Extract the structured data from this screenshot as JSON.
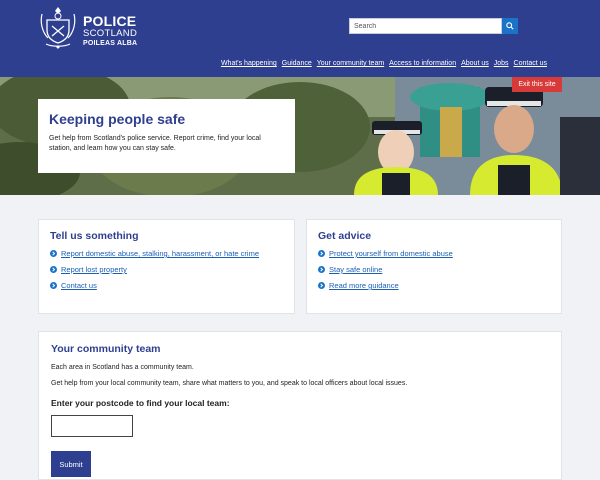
{
  "header": {
    "brand_line1": "POLICE",
    "brand_line2": "SCOTLAND",
    "brand_line3": "POILEAS ALBA",
    "search_placeholder": "Search",
    "nav": [
      "What's happening",
      "Guidance",
      "Your community team",
      "Access to information",
      "About us",
      "Jobs",
      "Contact us"
    ]
  },
  "hero": {
    "exit_label": "Exit this site",
    "title": "Keeping people safe",
    "text": "Get help from Scotland's police service. Report crime, find your local station, and learn how you can stay safe."
  },
  "tell_us": {
    "title": "Tell us something",
    "links": [
      "Report domestic abuse, stalking, harassment, or hate crime",
      "Report lost property",
      "Contact us"
    ]
  },
  "get_advice": {
    "title": "Get advice",
    "links": [
      "Protect yourself from domestic abuse",
      "Stay safe online",
      "Read more guidance"
    ]
  },
  "community": {
    "title": "Your community team",
    "p1": "Each area in Scotland has a community team.",
    "p2": "Get help from your local community team, share what matters to you, and speak to local officers about local issues.",
    "postcode_label": "Enter your postcode to find your local team:",
    "submit_label": "Submit"
  },
  "colors": {
    "brand_blue": "#2f3f8f",
    "link_blue": "#1a5fb4",
    "exit_red": "#d83a3a"
  }
}
